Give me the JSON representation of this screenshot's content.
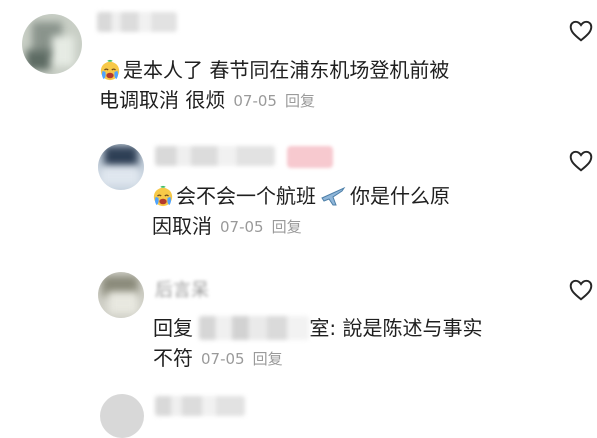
{
  "comments": [
    {
      "text": "是本人了 春节同在浦东机场登机前被电调取消 很烦",
      "line1": "是本人了 春节同在浦东机场登机前被",
      "line2": "电调取消 很烦",
      "date": "07-05",
      "reply_label": "回复",
      "emoji": "crying-face"
    },
    {
      "text": "会不会一个航班 你是什么原因取消",
      "line1a": "会不会一个航班",
      "line1b": "你是什么原",
      "line2": "因取消",
      "date": "07-05",
      "reply_label": "回复",
      "emoji": "crying-face",
      "emoji2": "airplane"
    },
    {
      "name_partial": "后言呆",
      "line1_prefix": "回复",
      "line1_suffix": "室: 說是陈述与事实",
      "line2": "不符",
      "date": "07-05",
      "reply_label": "回复"
    }
  ],
  "icons": {
    "like": "heart-outline-icon",
    "heart_color": "#262626"
  }
}
